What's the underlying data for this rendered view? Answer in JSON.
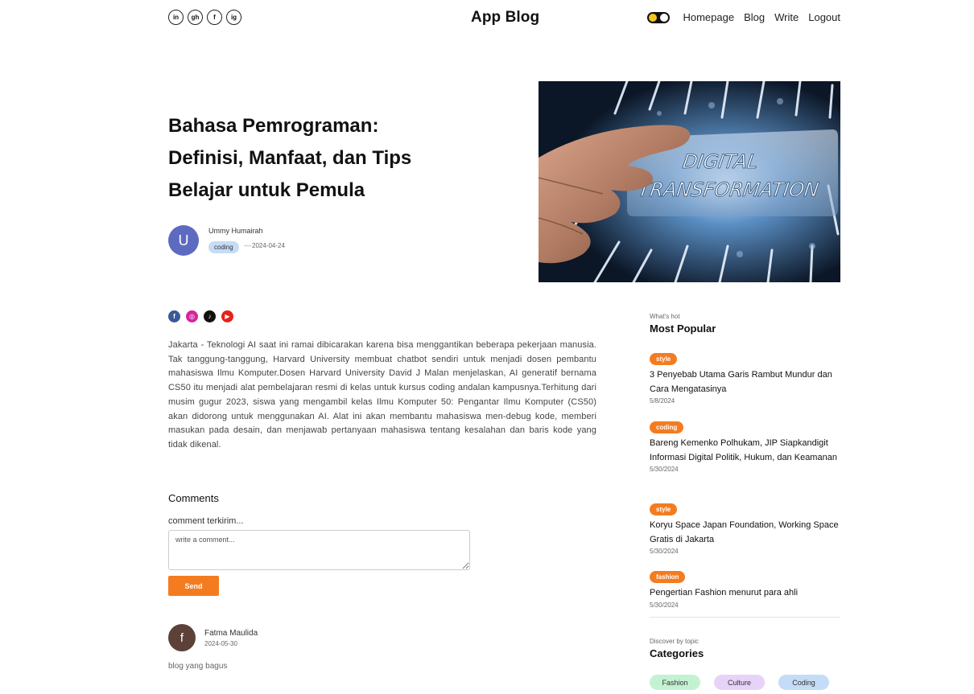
{
  "header": {
    "logo": "App Blog",
    "socials": [
      {
        "icon": "linkedin-icon",
        "glyph": "in"
      },
      {
        "icon": "github-icon",
        "glyph": "gh"
      },
      {
        "icon": "facebook-icon",
        "glyph": "f"
      },
      {
        "icon": "instagram-icon",
        "glyph": "ig"
      }
    ],
    "nav": [
      "Homepage",
      "Blog",
      "Write",
      "Logout"
    ]
  },
  "post": {
    "title": "Bahasa Pemrograman: Definisi, Manfaat, dan Tips Belajar untuk Pemula",
    "author_initial": "U",
    "author": "Ummy Humairah",
    "category": "coding",
    "date": "2024-04-24",
    "image_text_1": "DIGITAL",
    "image_text_2": "TRANSFORMATION",
    "body": "Jakarta - Teknologi AI saat ini ramai dibicarakan karena bisa menggantikan beberapa pekerjaan manusia. Tak tanggung-tanggung, Harvard University membuat chatbot sendiri untuk menjadi dosen pembantu mahasiswa Ilmu Komputer.Dosen Harvard University David J Malan menjelaskan, AI generatif bernama CS50 itu menjadi alat pembelajaran resmi di kelas untuk kursus coding andalan kampusnya.Terhitung dari musim gugur 2023, siswa yang mengambil kelas Ilmu Komputer 50: Pengantar Ilmu Komputer (CS50) akan didorong untuk menggunakan AI. Alat ini akan membantu mahasiswa men-debug kode, memberi masukan pada desain, dan menjawab pertanyaan mahasiswa tentang kesalahan dan baris kode yang tidak dikenal."
  },
  "share": [
    {
      "icon": "facebook-icon",
      "glyph": "f",
      "color": "#3b5998"
    },
    {
      "icon": "instagram-icon",
      "glyph": "◎",
      "color": "#d6249f"
    },
    {
      "icon": "tiktok-icon",
      "glyph": "♪",
      "color": "#111111"
    },
    {
      "icon": "youtube-icon",
      "glyph": "▶",
      "color": "#e62117"
    }
  ],
  "comments": {
    "title": "Comments",
    "status": "comment terkirim...",
    "placeholder": "write a comment...",
    "send": "Send",
    "items": [
      {
        "initial": "f",
        "name": "Fatma Maulida",
        "date": "2024-05-30",
        "text": "blog yang bagus"
      }
    ]
  },
  "sidebar": {
    "popular_sub": "What's hot",
    "popular_title": "Most Popular",
    "popular": [
      {
        "tag": "style",
        "title": "3 Penyebab Utama Garis Rambut Mundur dan Cara Mengatasinya",
        "date": "5/8/2024"
      },
      {
        "tag": "coding",
        "title": "Bareng Kemenko Polhukam, JIP Siapkandigit Informasi Digital Politik, Hukum, dan Keamanan",
        "date": "5/30/2024"
      },
      {
        "tag": "style",
        "title": "Koryu Space Japan Foundation, Working Space Gratis di Jakarta",
        "date": "5/30/2024"
      },
      {
        "tag": "fashion",
        "title": "Pengertian Fashion menurut para ahli",
        "date": "5/30/2024"
      }
    ],
    "categories_sub": "Discover by topic",
    "categories_title": "Categories",
    "categories": [
      {
        "label": "Fashion",
        "color": "#c3f2d2"
      },
      {
        "label": "Culture",
        "color": "#e6d3f7"
      },
      {
        "label": "Coding",
        "color": "#c5dcf7"
      }
    ]
  },
  "colors": {
    "accent": "#f47c20",
    "avatar_author": "#5c6bc0",
    "avatar_commenter": "#5d4037"
  }
}
